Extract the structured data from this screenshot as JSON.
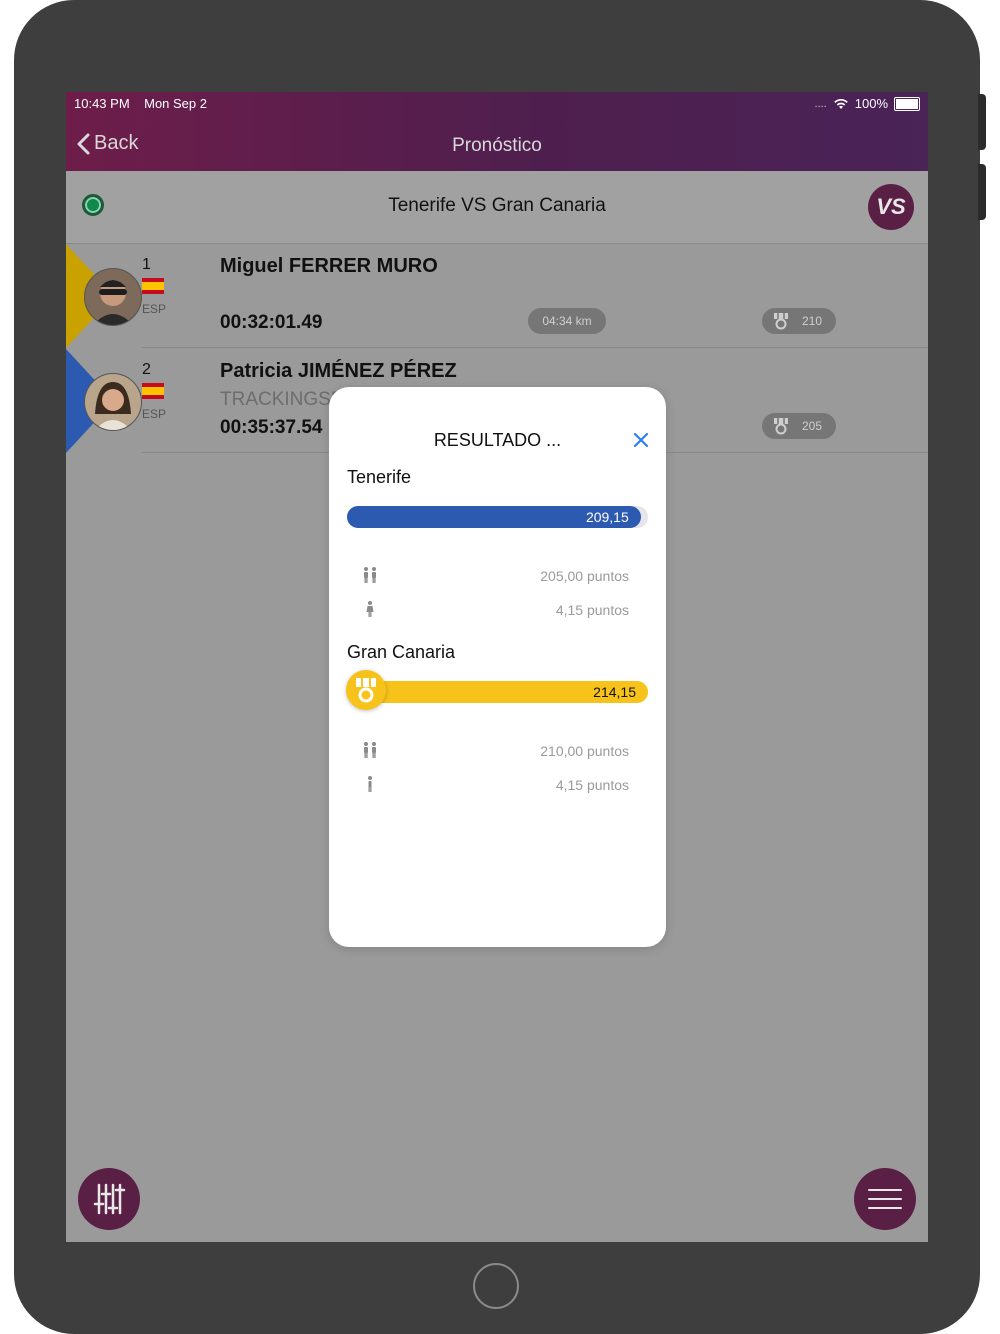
{
  "status_bar": {
    "time": "10:43 PM",
    "date": "Mon Sep 2",
    "battery": "100%",
    "signal_dots": "...."
  },
  "nav": {
    "back_label": "Back",
    "title": "Pronóstico"
  },
  "match": {
    "title": "Tenerife VS Gran Canaria",
    "vs_label": "VS"
  },
  "athletes": [
    {
      "rank": "1",
      "name": "Miguel FERRER MURO",
      "country": "ESP",
      "time": "00:32:01.49",
      "pace": "04:34 km",
      "points": "210",
      "sub": ""
    },
    {
      "rank": "2",
      "name": "Patricia JIMÉNEZ PÉREZ",
      "country": "ESP",
      "time": "00:35:37.54",
      "sub": "TRACKINGSP",
      "points": "205"
    }
  ],
  "modal": {
    "title": "RESULTADO ...",
    "teams": [
      {
        "name": "Tenerife",
        "total": "209,15",
        "fill_fraction": 0.976,
        "color": "#2c5ab0",
        "men_points": "205,00 puntos",
        "women_points": "4,15 puntos"
      },
      {
        "name": "Gran Canaria",
        "total": "214,15",
        "fill_fraction": 1.0,
        "color": "#f7c21a",
        "men_points": "210,00 puntos",
        "women_points": "4,15 puntos"
      }
    ]
  },
  "icons": {
    "filter": "sliders-icon",
    "menu": "hamburger-menu-icon",
    "medal": "medal-icon",
    "winner": "medal-icon"
  },
  "colors": {
    "brand": "#5a1f45",
    "live": "#0b8a4c",
    "rank1": "#c9a200",
    "rank2": "#2c5ab0",
    "close": "#2f7df6"
  }
}
